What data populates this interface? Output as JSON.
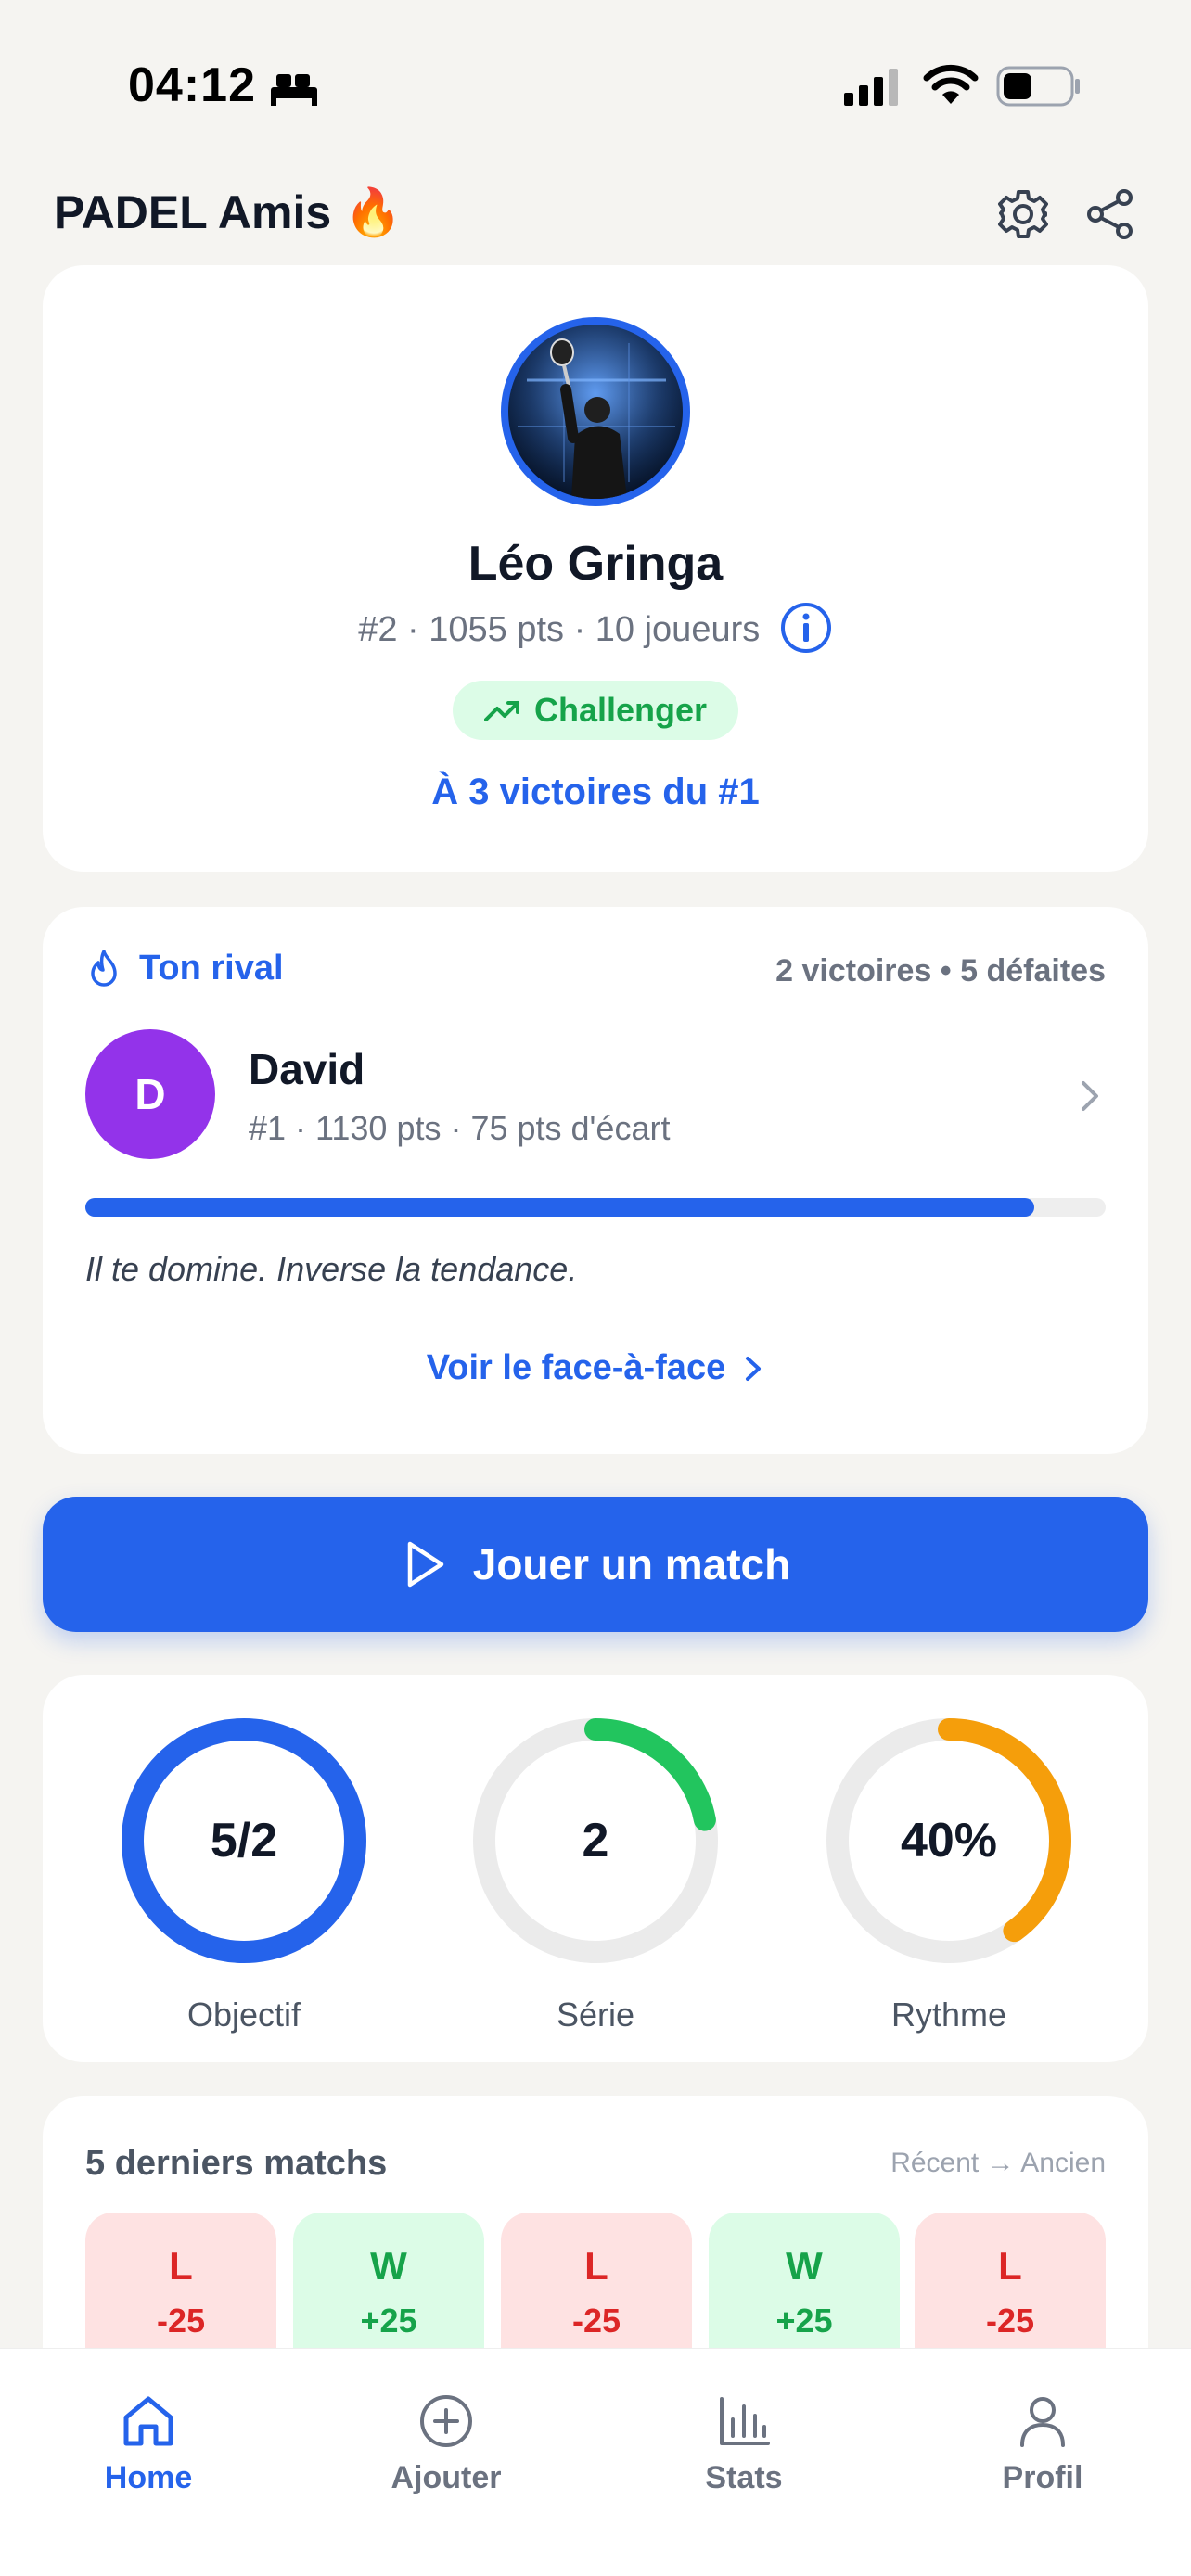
{
  "status_bar": {
    "time": "04:12",
    "icons": [
      "bed-icon",
      "cellular-signal-icon",
      "wifi-icon",
      "battery-icon"
    ]
  },
  "header": {
    "title": "PADEL Amis",
    "emoji": "🔥",
    "actions": [
      "gear-icon",
      "share-icon"
    ]
  },
  "profile": {
    "name": "Léo Gringa",
    "meta": "#2 · 1055 pts · 10 joueurs",
    "tier": "Challenger",
    "gap": "À 3 victoires du #1"
  },
  "rival": {
    "label": "Ton rival",
    "record": "2 victoires • 5 défaites",
    "initial": "D",
    "name": "David",
    "stats": "#1 · 1130 pts · 75 pts d'écart",
    "progress": 0.93,
    "tagline": "Il te domine. Inverse la tendance.",
    "link": "Voir le face-à-face"
  },
  "play_button": {
    "label": "Jouer un match"
  },
  "goals": [
    {
      "value": "5/2",
      "label": "Objectif",
      "fraction": 1.0,
      "color": "#2563EB"
    },
    {
      "value": "2",
      "label": "Série",
      "fraction": 0.22,
      "color": "#22C55E"
    },
    {
      "value": "40%",
      "label": "Rythme",
      "fraction": 0.4,
      "color": "#F59E0B"
    }
  ],
  "matches": {
    "title": "5 derniers matchs",
    "order": "Récent → Ancien",
    "items": [
      {
        "result": "L",
        "delta": "-25"
      },
      {
        "result": "W",
        "delta": "+25"
      },
      {
        "result": "L",
        "delta": "-25"
      },
      {
        "result": "W",
        "delta": "+25"
      },
      {
        "result": "L",
        "delta": "-25"
      }
    ]
  },
  "tabs": [
    {
      "label": "Home",
      "icon": "home-icon",
      "active": true
    },
    {
      "label": "Ajouter",
      "icon": "plus-circle-icon",
      "active": false
    },
    {
      "label": "Stats",
      "icon": "bar-chart-icon",
      "active": false
    },
    {
      "label": "Profil",
      "icon": "user-icon",
      "active": false
    }
  ],
  "colors": {
    "accent": "#2563EB",
    "win": "#16A34A",
    "loss": "#DC2626",
    "rival_avatar": "#9333EA",
    "background": "#F5F4F1"
  }
}
